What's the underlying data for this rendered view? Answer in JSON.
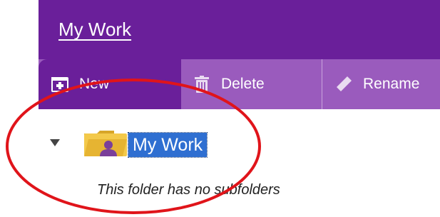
{
  "header": {
    "title": "My Work"
  },
  "toolbar": {
    "new_label": "New",
    "delete_label": "Delete",
    "rename_label": "Rename"
  },
  "tree": {
    "folder_name": "My Work",
    "empty_message": "This folder has no subfolders"
  },
  "colors": {
    "header_bg": "#6a1f9a",
    "toolbar_bg": "#9a5bbd",
    "selection_bg": "#2f6fd1",
    "annotation": "#e0141a"
  },
  "icons": {
    "new": "new-folder-icon",
    "delete": "trash-icon",
    "rename": "pencil-icon",
    "expander": "expand-triangle-icon",
    "folder": "user-folder-icon"
  }
}
